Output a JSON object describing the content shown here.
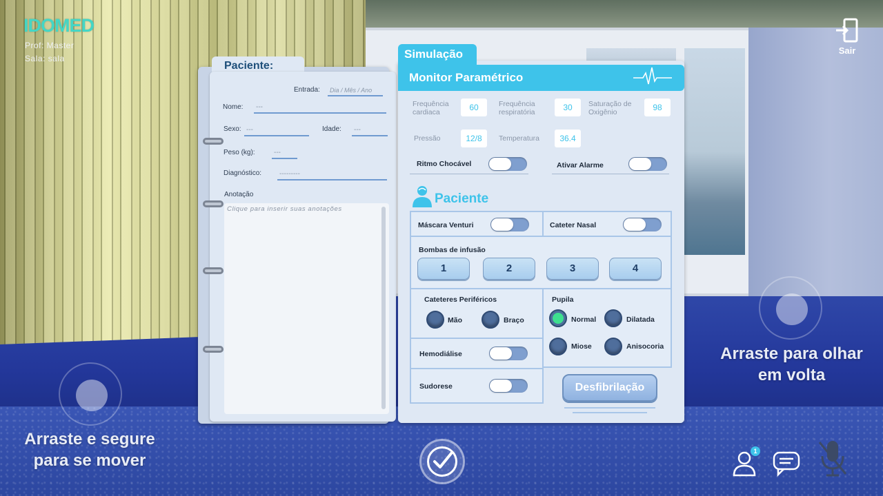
{
  "brand": {
    "logo": "IDOMED",
    "prof": "Prof: Master",
    "sala": "Sala: sala"
  },
  "exit": {
    "label": "Sair",
    "icon": "exit-door-icon"
  },
  "patient_form": {
    "tab": "Paciente:",
    "entrada_label": "Entrada:",
    "entrada_placeholder": "Dia / Mês / Ano",
    "nome_label": "Nome:",
    "nome_value": "---",
    "sexo_label": "Sexo:",
    "sexo_value": "---",
    "idade_label": "Idade:",
    "idade_value": "---",
    "peso_label": "Peso (kg):",
    "peso_value": "---",
    "diagnostico_label": "Diagnóstico:",
    "diagnostico_value": "---------",
    "anotacao_label": "Anotação",
    "anotacao_placeholder": "Clique para inserir suas anotações"
  },
  "simulation": {
    "tab": "Simulação",
    "monitor_title": "Monitor Paramétrico",
    "params": {
      "freq_cardiaca_label": "Frequência cardiaca",
      "freq_cardiaca_value": "60",
      "freq_resp_label": "Frequência respiratória",
      "freq_resp_value": "30",
      "saturacao_label": "Saturação de Oxigênio",
      "saturacao_value": "98",
      "pressao_label": "Pressão",
      "pressao_value": "12/8",
      "temperatura_label": "Temperatura",
      "temperatura_value": "36.4"
    },
    "toggles": {
      "ritmo_label": "Ritmo Chocável",
      "alarme_label": "Ativar Alarme"
    }
  },
  "paciente": {
    "title": "Paciente",
    "mascara_label": "Máscara Venturi",
    "cateter_nasal_label": "Cateter Nasal",
    "bombas_label": "Bombas de infusão",
    "bombas": [
      "1",
      "2",
      "3",
      "4"
    ],
    "cateteres_label": "Cateteres Periféricos",
    "cateteres_options": [
      "Mão",
      "Braço"
    ],
    "pupila_label": "Pupila",
    "pupila_options": [
      "Normal",
      "Dilatada",
      "Miose",
      "Anisocoria"
    ],
    "pupila_selected": "Normal",
    "hemodialise_label": "Hemodiálise",
    "sudorese_label": "Sudorese",
    "defib_label": "Desfibrilação"
  },
  "hints": {
    "move": "Arraste e segure para se mover",
    "look": "Arraste para olhar em volta"
  },
  "bottom": {
    "users_badge": "1",
    "icons": [
      "check-icon",
      "user-icon",
      "chat-icon",
      "mic-muted-icon"
    ]
  },
  "colors": {
    "accent": "#3ec3ea",
    "brand": "#44d6c5",
    "selected": "#3ee08f"
  }
}
